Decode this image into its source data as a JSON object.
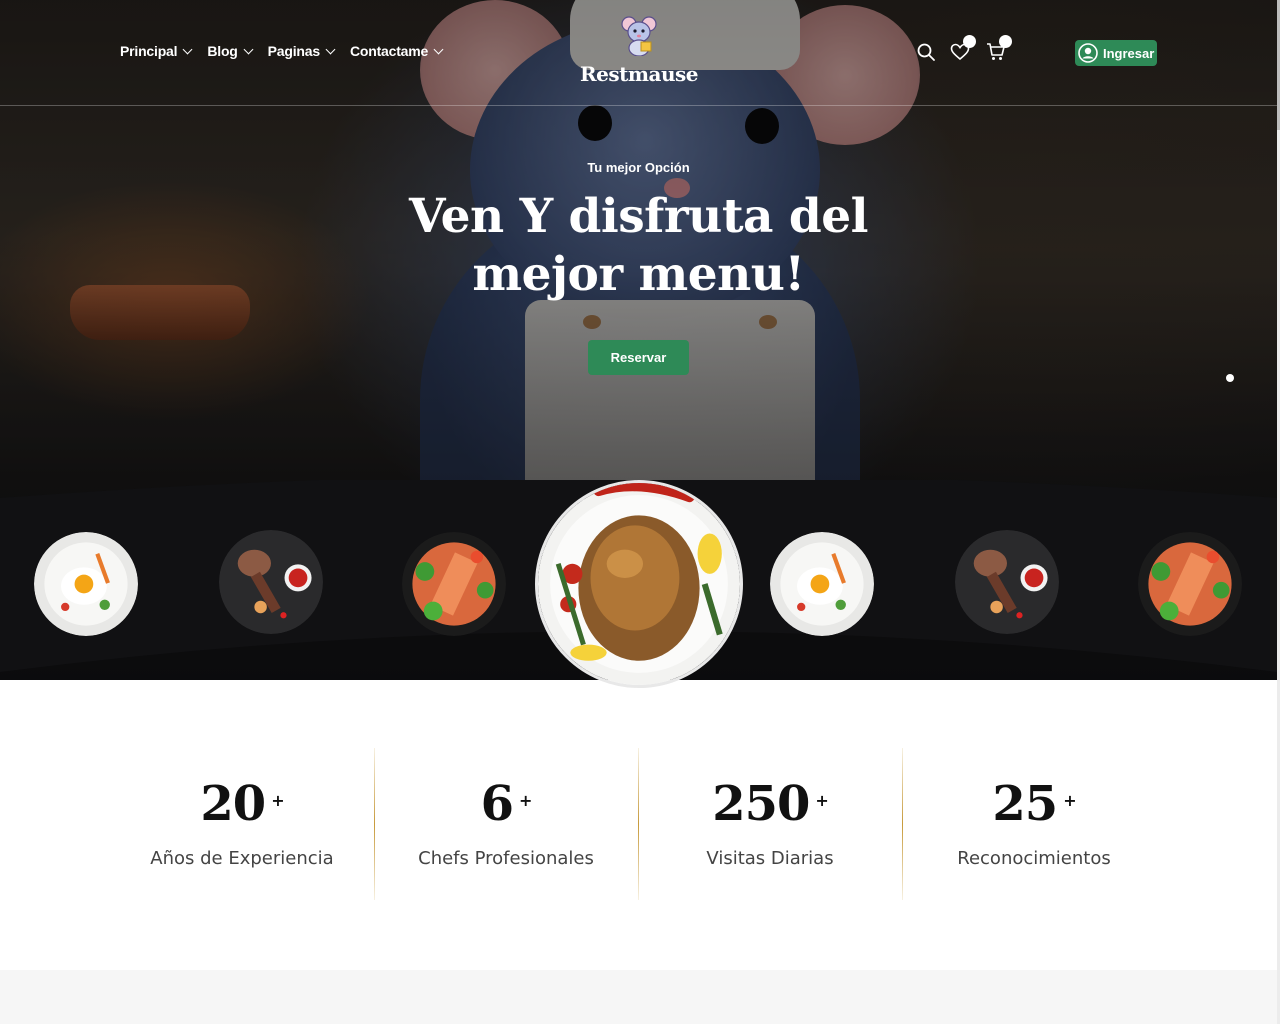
{
  "nav": {
    "items": [
      {
        "label": "Principal"
      },
      {
        "label": "Blog"
      },
      {
        "label": "Paginas"
      },
      {
        "label": "Contactame"
      }
    ]
  },
  "brand": {
    "name": "Restmause"
  },
  "header": {
    "icons": [
      "search-icon",
      "heart-icon",
      "cart-icon"
    ],
    "login_label": "Ingresar"
  },
  "hero": {
    "eyebrow": "Tu mejor Opción",
    "title": "Ven Y disfruta del mejor menu!",
    "cta_label": "Reservar"
  },
  "plates": [
    "egg-plate",
    "steak-plate",
    "salmon-plate",
    "roast-chicken-plate",
    "egg-plate",
    "steak-plate",
    "salmon-plate"
  ],
  "stats": [
    {
      "value": "20",
      "suffix": "+",
      "label": "Años de Experiencia"
    },
    {
      "value": "6",
      "suffix": "+",
      "label": "Chefs Profesionales"
    },
    {
      "value": "250",
      "suffix": "+",
      "label": "Visitas Diarias"
    },
    {
      "value": "25",
      "suffix": "+",
      "label": "Reconocimientos"
    }
  ],
  "colors": {
    "accent": "#2e8a57",
    "divider": "#c89b3c",
    "dark": "#111113"
  }
}
